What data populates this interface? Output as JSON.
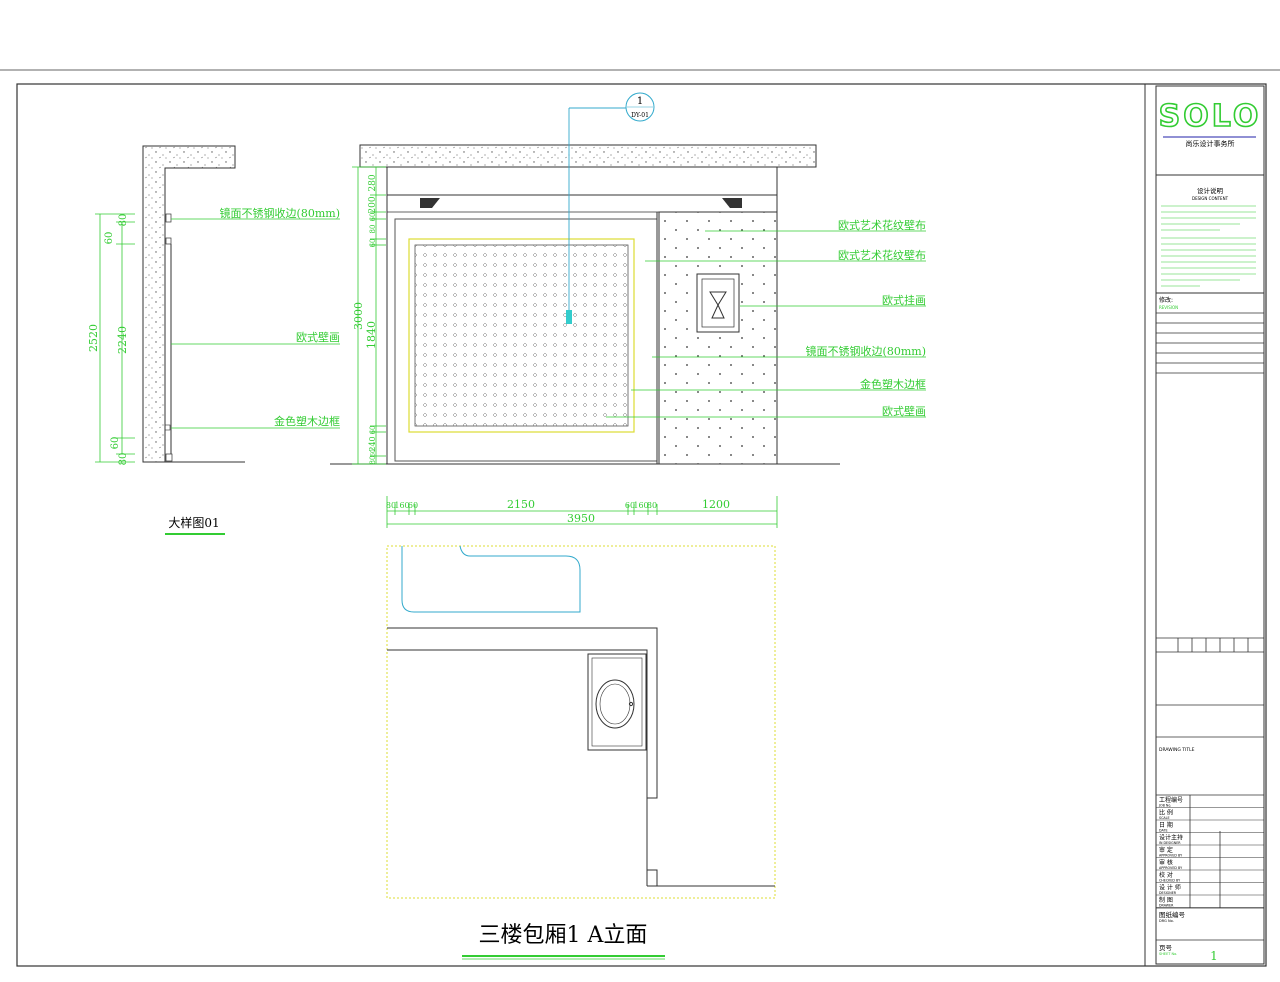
{
  "title_block": {
    "logo": "SOLO",
    "firm_name": "尚乐设计事务所",
    "design_notes_title": "设计说明",
    "design_notes_subtitle": "DESIGN CONTENT",
    "revision_label": "修改:",
    "revision_sub": "REVISION",
    "drawing_title_label": "DRAWING TITLE",
    "rows": [
      {
        "cn": "工程编号",
        "en": "JOB No."
      },
      {
        "cn": "比 例",
        "en": "SCALE"
      },
      {
        "cn": "日 期",
        "en": "DATE"
      },
      {
        "cn": "设计主持",
        "en": "IN DESIGNER"
      },
      {
        "cn": "审 定",
        "en": "APPROVED BY"
      },
      {
        "cn": "审 核",
        "en": "APPROVED BY"
      },
      {
        "cn": "校 对",
        "en": "CHECKED BY"
      },
      {
        "cn": "设 计 师",
        "en": "DESIGNER"
      },
      {
        "cn": "制 图",
        "en": "DRAWER"
      }
    ],
    "drawing_no_label": "图纸编号",
    "drawing_no_sub": "DRG No.",
    "sheet_label": "页号",
    "sheet_sub": "SHEET No.",
    "sheet_no": "1"
  },
  "callout": {
    "number": "1",
    "ref": "DY-01"
  },
  "elevation_labels": [
    "欧式艺术花纹壁布",
    "欧式艺术花纹壁布",
    "欧式挂画",
    "镜面不锈钢收边(80mm)",
    "金色塑木边框",
    "欧式壁画"
  ],
  "detail_labels": [
    "镜面不锈钢收边(80mm)",
    "欧式壁画",
    "金色塑木边框"
  ],
  "detail_title": "大样图01",
  "detail_dims": {
    "total": "2520",
    "mid": "2240",
    "top1": "80",
    "top2": "60",
    "bot1": "60",
    "bot2": "80"
  },
  "elev_vertical_dims": {
    "total": "3000",
    "d280": "280",
    "d200": "200",
    "d60a": "60",
    "d80a": "80",
    "d60b": "60",
    "d1840": "1840",
    "d60c": "60",
    "d240": "240",
    "d80b": "80",
    "d60d": "60"
  },
  "elev_horizontal_dims": {
    "d80": "80",
    "d160": "160",
    "d60": "60",
    "d2150": "2150",
    "d60b": "60",
    "d160b": "160",
    "d80b": "80",
    "d1200": "1200",
    "total": "3950"
  },
  "drawing_title": "三楼包厢1 A立面"
}
